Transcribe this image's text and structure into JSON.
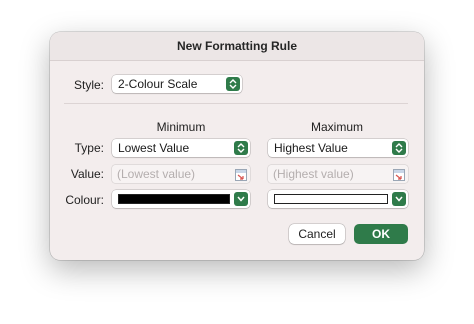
{
  "dialog": {
    "title": "New Formatting Rule",
    "style_label": "Style:",
    "style_value": "2-Colour Scale",
    "minimum_header": "Minimum",
    "maximum_header": "Maximum",
    "type_label": "Type:",
    "value_label": "Value:",
    "colour_label": "Colour:",
    "min_type": "Lowest Value",
    "max_type": "Highest Value",
    "min_value_placeholder": "(Lowest value)",
    "max_value_placeholder": "(Highest value)",
    "min_colour": "#000000",
    "max_colour": "#ffffff",
    "cancel_label": "Cancel",
    "ok_label": "OK",
    "accent_color": "#2f7b4a"
  }
}
